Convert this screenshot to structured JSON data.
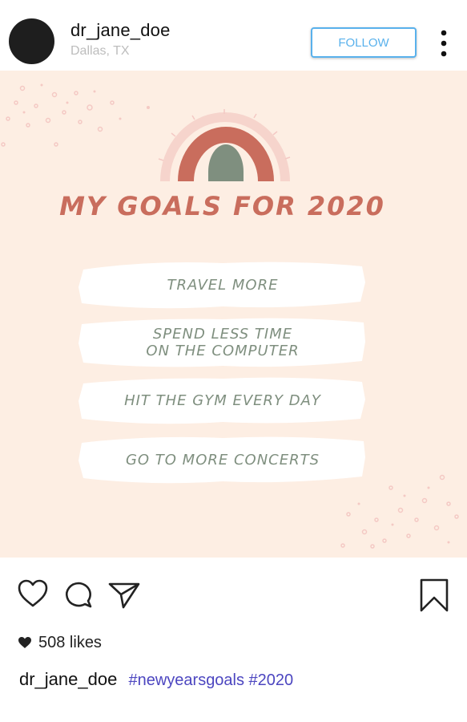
{
  "header": {
    "username": "dr_jane_doe",
    "location": "Dallas, TX",
    "follow_label": "FOLLOW"
  },
  "post": {
    "title": "MY GOALS FOR 2020",
    "goals": [
      {
        "text": "TRAVEL MORE"
      },
      {
        "text": "SPEND LESS TIME\nON THE COMPUTER"
      },
      {
        "text": "HIT THE GYM EVERY DAY"
      },
      {
        "text": "GO TO MORE CONCERTS"
      }
    ]
  },
  "actions": {
    "icons": [
      "heart-icon",
      "comment-icon",
      "share-icon",
      "bookmark-icon"
    ]
  },
  "likes": {
    "text": "508 likes"
  },
  "caption": {
    "username": "dr_jane_doe",
    "hashtags": "#newyearsgoals #2020"
  },
  "colors": {
    "post_background": "#fdeee3",
    "title_color": "#c96d5d",
    "goal_text_color": "#7f8f7f",
    "follow_accent": "#59b1ec",
    "hashtag_color": "#4c46c0"
  }
}
